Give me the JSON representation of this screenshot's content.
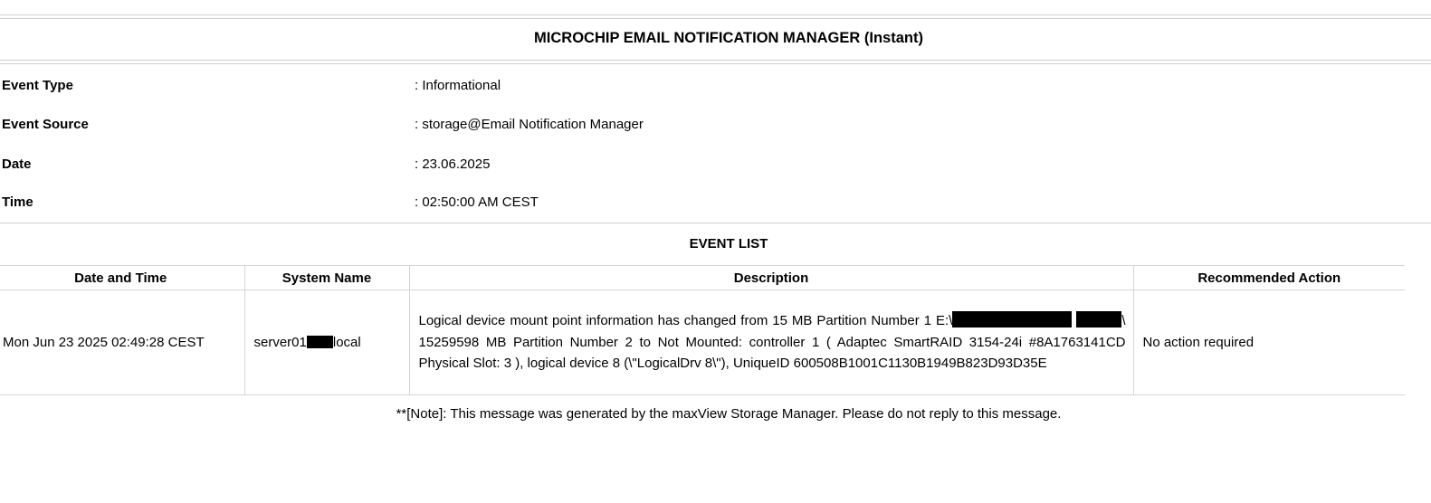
{
  "header": {
    "title": "MICROCHIP EMAIL NOTIFICATION MANAGER (Instant)"
  },
  "info": {
    "event_type": {
      "label": "Event Type",
      "value": ": Informational"
    },
    "event_source": {
      "label": "Event Source",
      "value": ": storage@Email Notification Manager"
    },
    "date": {
      "label": "Date",
      "value": ": 23.06.2025"
    },
    "time": {
      "label": "Time",
      "value": ": 02:50:00 AM CEST"
    }
  },
  "event_list": {
    "title": "EVENT LIST",
    "columns": [
      "Date and Time",
      "System Name",
      "Description",
      "Recommended Action"
    ],
    "rows": [
      {
        "date_time": "Mon Jun 23 2025 02:49:28 CEST",
        "system_prefix": "server01",
        "system_suffix": "local",
        "desc_part1": "Logical device mount point information has changed from 15 MB Partition Number 1 E:\\",
        "desc_part2": "\\ 15259598 MB Partition Number 2 to Not Mounted: controller 1 ( Adaptec SmartRAID 3154-24i #8A1763141CD Physical Slot: 3 ), logical device 8 (\\\"LogicalDrv 8\\\"), UniqueID 600508B1001C1130B1949B823D93D35E",
        "action": "No action required"
      }
    ]
  },
  "footer": {
    "note": "**[Note]: This message was generated by the maxView Storage Manager. Please do not reply to this message."
  }
}
